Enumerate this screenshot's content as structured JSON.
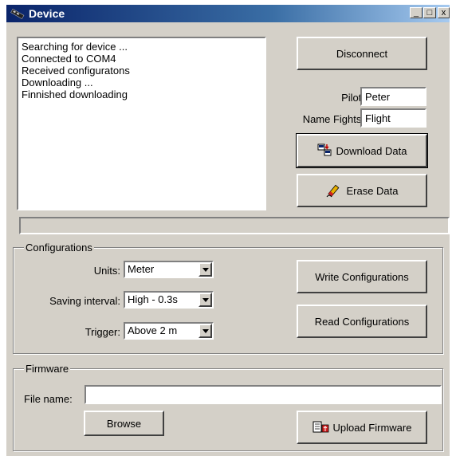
{
  "window": {
    "title": "Device",
    "minimize_glyph": "_",
    "maximize_glyph": "□",
    "close_glyph": "x"
  },
  "log": {
    "lines": [
      "Searching for device ...",
      "Connected to COM4",
      "Received configuratons",
      "Downloading ...",
      "Finnished downloading"
    ]
  },
  "connection": {
    "disconnect_label": "Disconnect",
    "pilot_label": "Pilot:",
    "pilot_value": "Peter",
    "name_flights_label": "Name Fights:",
    "name_flights_value": "Flight",
    "download_label": "Download Data",
    "erase_label": "Erase Data"
  },
  "configurations": {
    "group_title": "Configurations",
    "units_label": "Units:",
    "units_value": "Meter",
    "saving_label": "Saving interval:",
    "saving_value": "High - 0.3s",
    "trigger_label": "Trigger:",
    "trigger_value": "Above 2 m",
    "write_label": "Write Configurations",
    "read_label": "Read Configurations"
  },
  "firmware": {
    "group_title": "Firmware",
    "file_label": "File name:",
    "file_value": "",
    "browse_label": "Browse",
    "upload_label": "Upload Firmware"
  },
  "icons": {
    "title": "device-icon",
    "download": "download-icon",
    "erase": "eraser-icon",
    "upload": "upload-icon"
  }
}
